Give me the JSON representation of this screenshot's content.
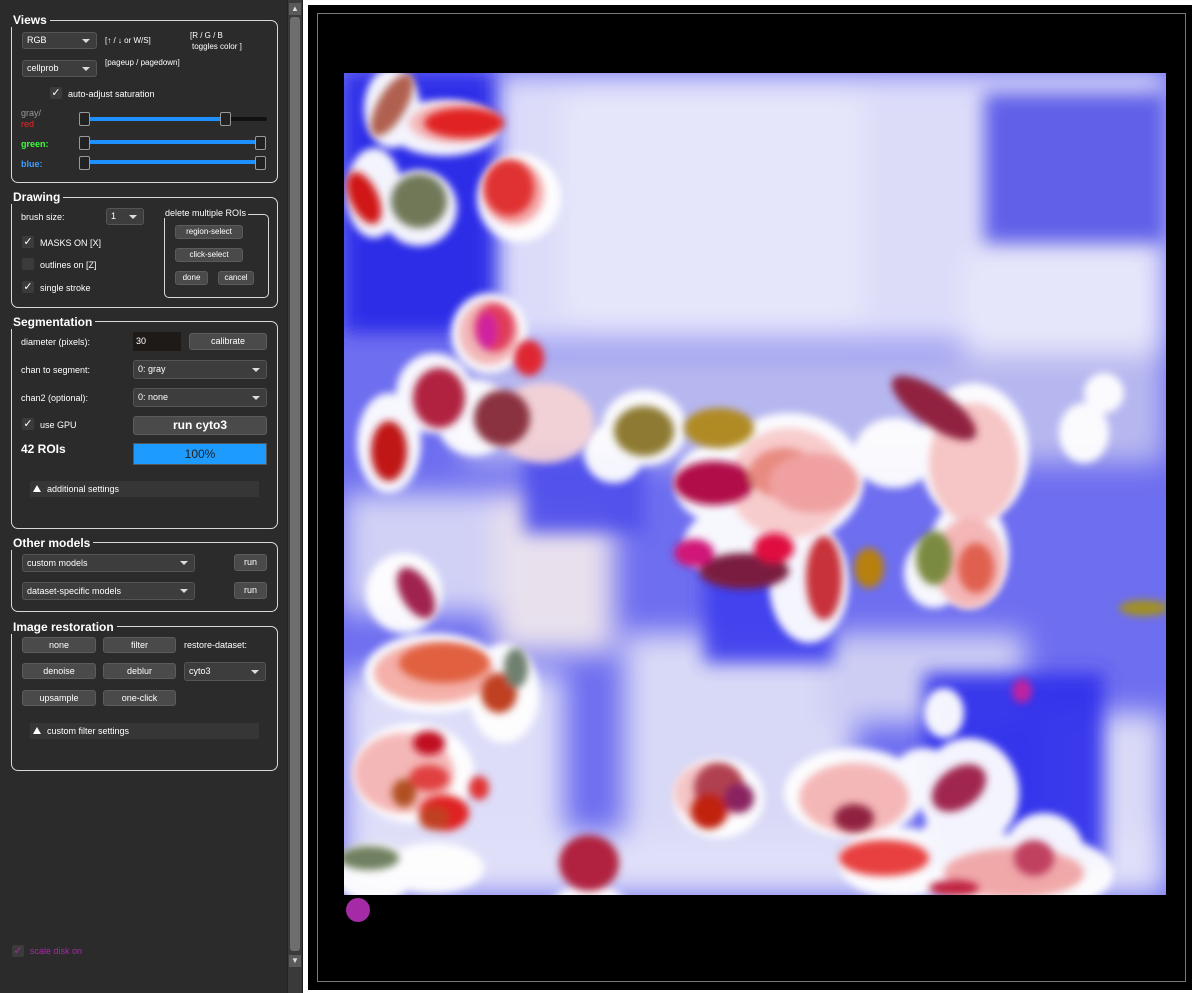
{
  "views": {
    "title": "Views",
    "color_mode": "RGB",
    "color_hint": "[↑ / ↓ or W/S]",
    "rgb_hint_line1": "[R / G / B",
    "rgb_hint_line2": "toggles color ]",
    "view_select": "cellprob",
    "page_hint": "[pageup / pagedown]",
    "auto_adjust": "auto-adjust saturation",
    "gray_label_1": "gray/",
    "gray_label_2": "red",
    "green_label": "green:",
    "blue_label": "blue:",
    "check": "✓"
  },
  "drawing": {
    "title": "Drawing",
    "brush_label": "brush size:",
    "brush_value": "1",
    "masks_on": "MASKS ON [X]",
    "outlines_on": "outlines on [Z]",
    "single_stroke": "single stroke",
    "delete_group_title": "delete multiple ROIs",
    "region_select": "region-select",
    "click_select": "click-select",
    "done": "done",
    "cancel": "cancel"
  },
  "segmentation": {
    "title": "Segmentation",
    "diameter_label": "diameter (pixels):",
    "diameter_value": "30",
    "calibrate": "calibrate",
    "chan_label": "chan to segment:",
    "chan_value": "0: gray",
    "chan2_label": "chan2 (optional):",
    "chan2_value": "0: none",
    "use_gpu": "use GPU",
    "run_button": "run cyto3",
    "roi_count": "42 ROIs",
    "progress": "100%",
    "progress_fraction": 1.0,
    "additional": "additional settings"
  },
  "other_models": {
    "title": "Other models",
    "custom": "custom models",
    "dataset": "dataset-specific models",
    "run": "run"
  },
  "restoration": {
    "title": "Image restoration",
    "none": "none",
    "filter": "filter",
    "restore_label": "restore-dataset:",
    "denoise": "denoise",
    "deblur": "deblur",
    "restore_value": "cyto3",
    "upsample": "upsample",
    "one_click": "one-click",
    "custom_filter": "custom filter settings"
  },
  "footer": {
    "scale_disk": "scale disk on"
  },
  "colors": {
    "panel_bg": "#2b2b2b",
    "progress_blue": "#1e9bff",
    "green_label": "#3cff3c",
    "blue_label": "#3ca0ff",
    "red_label": "#ff2020",
    "scale_disk": "#a52aa5"
  }
}
